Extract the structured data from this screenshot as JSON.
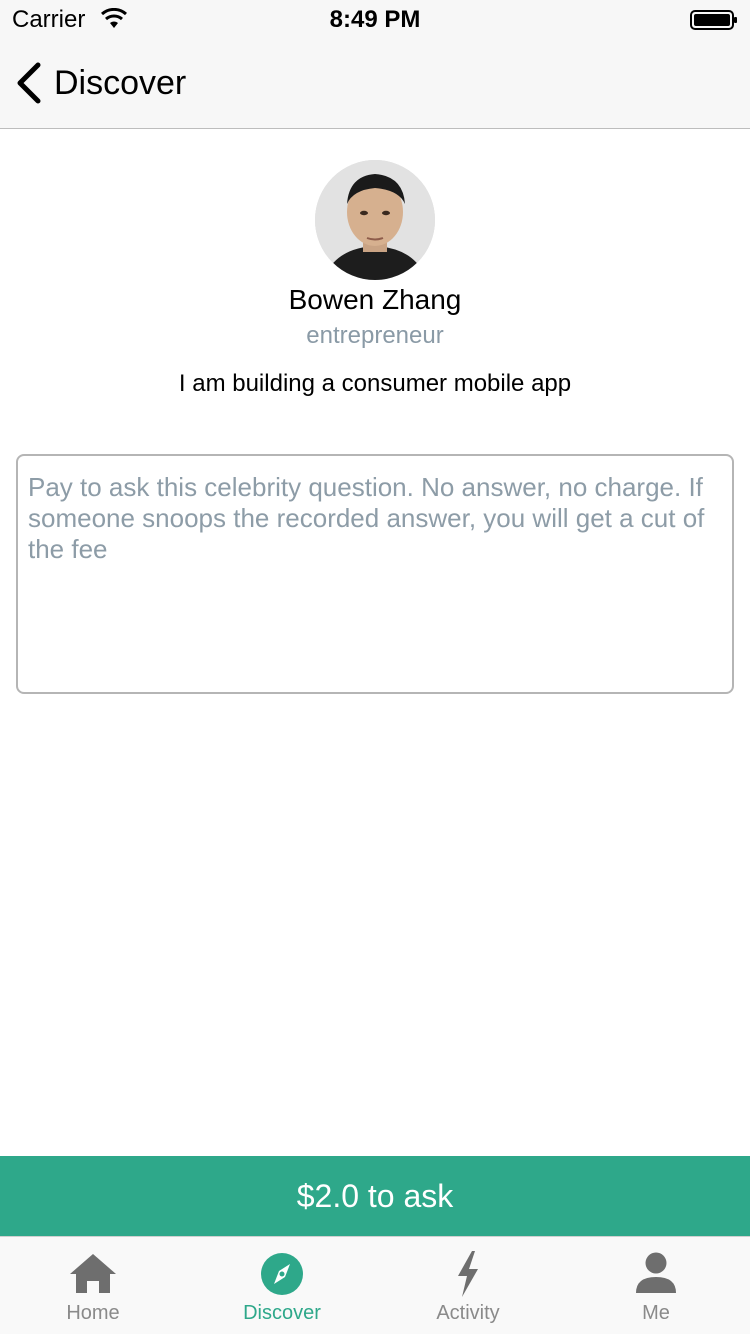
{
  "status_bar": {
    "carrier": "Carrier",
    "time": "8:49 PM"
  },
  "nav": {
    "back_label": "Discover"
  },
  "profile": {
    "name": "Bowen Zhang",
    "title": "entrepreneur",
    "bio": "I am building a consumer mobile app"
  },
  "question": {
    "placeholder": "Pay to ask this celebrity question. No answer, no charge. If someone snoops the recorded answer, you will get a cut of the fee",
    "value": ""
  },
  "ask_button": {
    "label": "$2.0 to ask"
  },
  "tabs": [
    {
      "label": "Home",
      "icon": "home-icon",
      "active": false
    },
    {
      "label": "Discover",
      "icon": "compass-icon",
      "active": true
    },
    {
      "label": "Activity",
      "icon": "lightning-icon",
      "active": false
    },
    {
      "label": "Me",
      "icon": "person-icon",
      "active": false
    }
  ],
  "colors": {
    "accent": "#2ea88a",
    "tab_inactive": "#8a8a8a",
    "placeholder": "#8d9ca7",
    "bar_background": "#f7f7f7"
  }
}
